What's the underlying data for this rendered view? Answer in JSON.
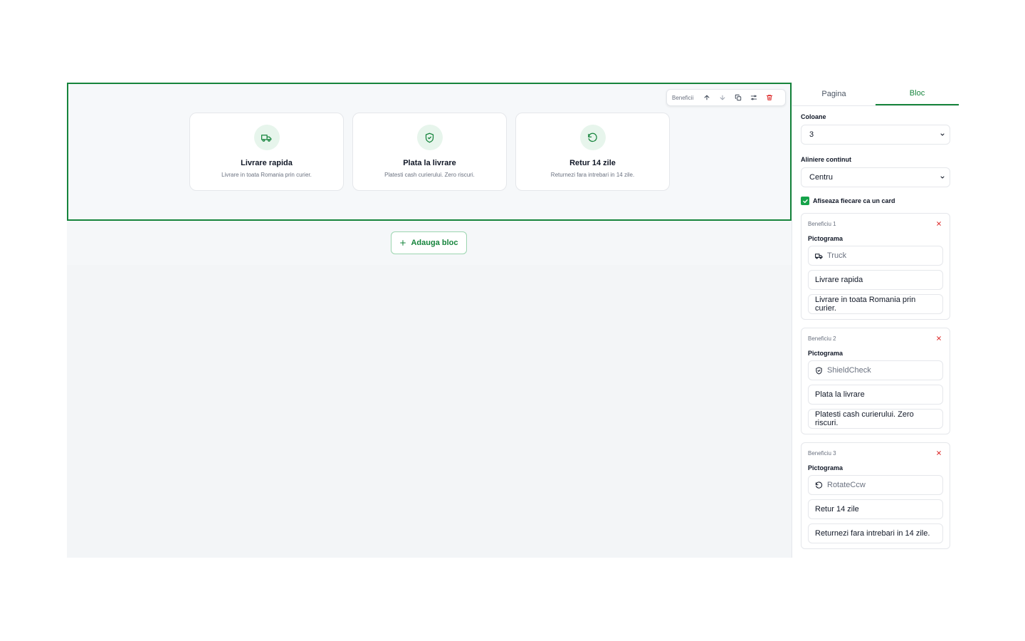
{
  "block": {
    "toolbar_label": "Beneficii",
    "cards": [
      {
        "icon": "truck-icon",
        "title": "Livrare rapida",
        "desc": "Livrare in toata Romania prin curier."
      },
      {
        "icon": "shield-check-icon",
        "title": "Plata la livrare",
        "desc": "Platesti cash curierului. Zero riscuri."
      },
      {
        "icon": "rotate-ccw-icon",
        "title": "Retur 14 zile",
        "desc": "Returnezi fara intrebari in 14 zile."
      }
    ]
  },
  "canvas": {
    "add_block_label": "Adauga bloc"
  },
  "panel": {
    "tabs": [
      "Pagina",
      "Bloc"
    ],
    "active_tab": "Bloc",
    "columns": {
      "label": "Coloane",
      "value": "3"
    },
    "alignment": {
      "label": "Aliniere continut",
      "value": "Centru"
    },
    "show_card": {
      "label": "Afiseaza fiecare ca un card",
      "checked": true
    },
    "benefits": [
      {
        "heading": "Beneficiu 1",
        "icon_label": "Pictograma",
        "icon_value": "Truck",
        "title": "Livrare rapida",
        "desc": "Livrare in toata Romania prin curier."
      },
      {
        "heading": "Beneficiu 2",
        "icon_label": "Pictograma",
        "icon_value": "ShieldCheck",
        "title": "Plata la livrare",
        "desc": "Platesti cash curierului. Zero riscuri."
      },
      {
        "heading": "Beneficiu 3",
        "icon_label": "Pictograma",
        "icon_value": "RotateCcw",
        "title": "Retur 14 zile",
        "desc": "Returnezi fara intrebari in 14 zile."
      }
    ]
  },
  "colors": {
    "accent": "#16843c",
    "icon_bg": "#e7f5ec",
    "danger": "#dc2626"
  }
}
